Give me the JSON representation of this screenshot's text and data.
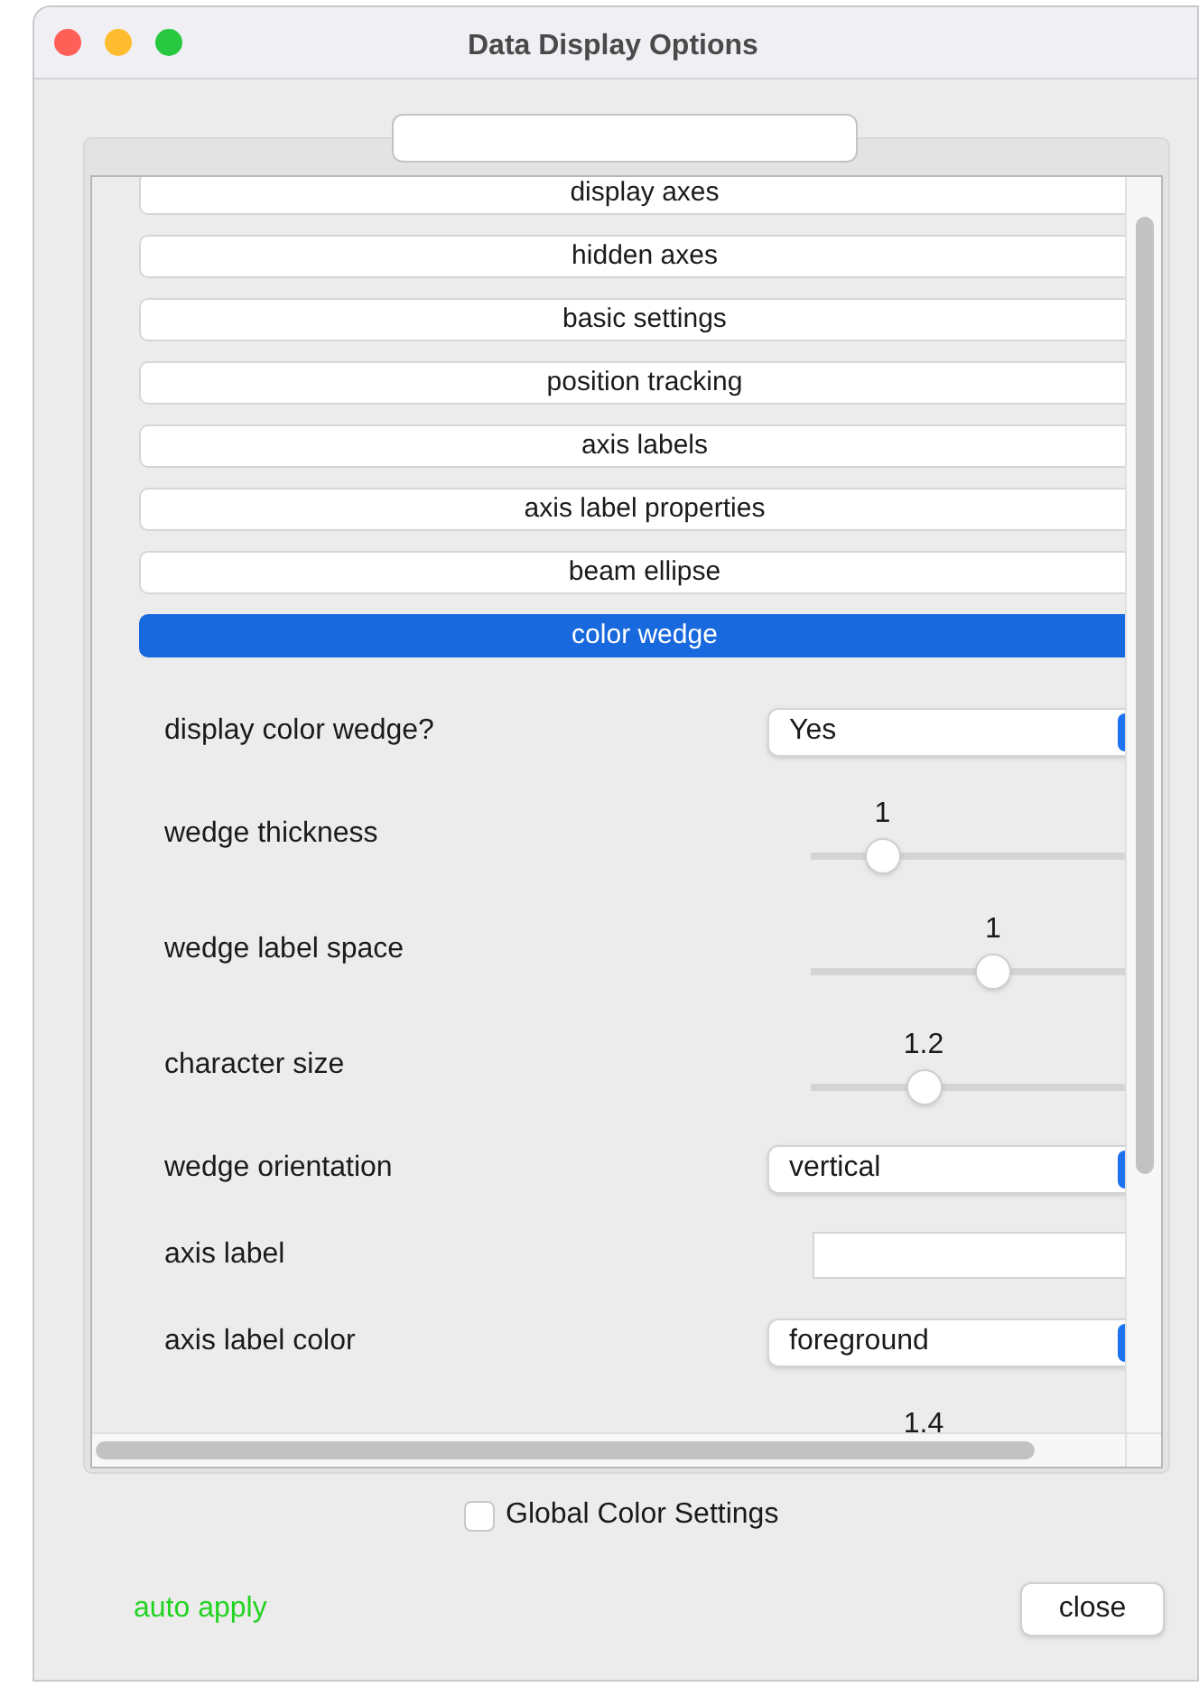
{
  "window": {
    "title": "Data Display Options"
  },
  "sections": [
    {
      "label": "display axes",
      "selected": false
    },
    {
      "label": "hidden axes",
      "selected": false
    },
    {
      "label": "basic settings",
      "selected": false
    },
    {
      "label": "position tracking",
      "selected": false
    },
    {
      "label": "axis labels",
      "selected": false
    },
    {
      "label": "axis label properties",
      "selected": false
    },
    {
      "label": "beam ellipse",
      "selected": false
    },
    {
      "label": "color wedge",
      "selected": true
    }
  ],
  "options": [
    {
      "kind": "dropdown",
      "label": "display color wedge?",
      "value": "Yes"
    },
    {
      "kind": "slider",
      "label": "wedge thickness",
      "reading": "1",
      "level": 0.17
    },
    {
      "kind": "slider",
      "label": "wedge label space",
      "reading": "1",
      "level": 0.52
    },
    {
      "kind": "slider",
      "label": "character size",
      "reading": "1.2",
      "level": 0.3
    },
    {
      "kind": "dropdown",
      "label": "wedge orientation",
      "value": "vertical"
    },
    {
      "kind": "text",
      "label": "axis label"
    },
    {
      "kind": "dropdown",
      "label": "axis label color",
      "value": "foreground"
    },
    {
      "kind": "slider",
      "reading": "1.4"
    }
  ],
  "global_color_settings": {
    "label": "Global Color Settings",
    "checked": false
  },
  "auto_apply": "auto apply",
  "close_button": "close"
}
